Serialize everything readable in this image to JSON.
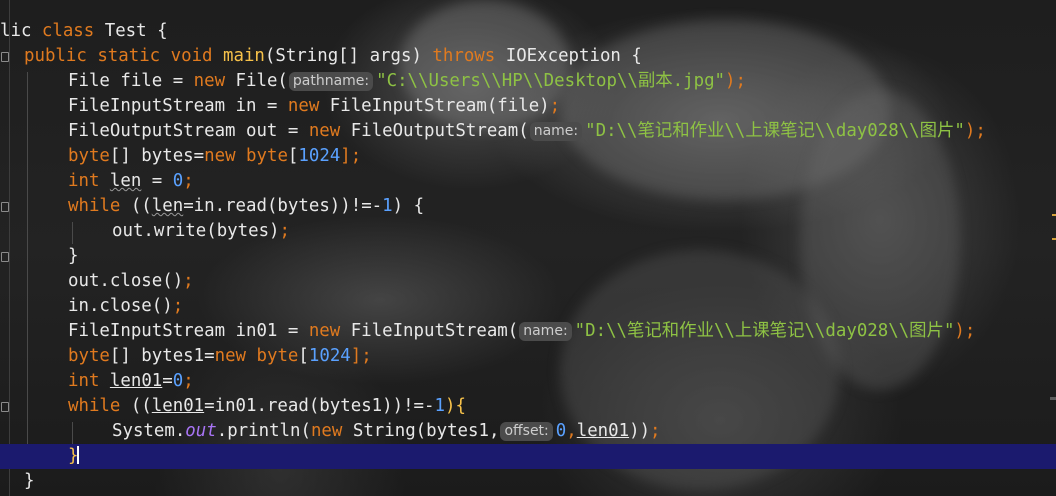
{
  "editor": {
    "colors": {
      "keyword": "#e07a1f",
      "method": "#f7c24a",
      "number": "#5aa1ff",
      "string": "#8ec244",
      "field": "#a874f4",
      "text": "#e8e8e8",
      "current_line": "#1b1a6e"
    },
    "lines": {
      "l1": {
        "a": "lic ",
        "b": "class",
        "c": " Test {"
      },
      "l2": {
        "a": "public",
        "b": " ",
        "c": "static",
        "d": " ",
        "e": "void",
        "f": " ",
        "g": "main",
        "h": "(String[] args) ",
        "i": "throws",
        "j": " IOException {"
      },
      "l3": {
        "a": "File file = ",
        "b": "new",
        "c": " File(",
        "hint": "pathname:",
        "str": "\"C:\\\\Users\\\\HP\\\\Desktop\\\\副本.jpg\"",
        "end": ");"
      },
      "l4": {
        "a": "FileInputStream in = ",
        "b": "new",
        "c": " FileInputStream(file)",
        "d": ";"
      },
      "l5": {
        "a": "FileOutputStream out = ",
        "b": "new",
        "c": " FileOutputStream(",
        "hint": "name:",
        "str": "\"D:\\\\笔记和作业\\\\上课笔记\\\\day028\\\\图片\"",
        "end": ");"
      },
      "l6": {
        "a": "byte",
        "b": "[] bytes=",
        "c": "new",
        "d": " ",
        "e": "byte",
        "f": "[",
        "g": "1024",
        "h": "];"
      },
      "l7": {
        "a": "int",
        "b": " ",
        "c": "len",
        "d": " = ",
        "e": "0",
        "f": ";"
      },
      "l8": {
        "a": "while",
        "b": " ((",
        "c": "len",
        "d": "=in.read(bytes))!=-",
        "e": "1",
        "f": ") {"
      },
      "l9": {
        "a": "out.write(bytes)",
        "b": ";"
      },
      "l10": {
        "a": "}"
      },
      "l11": {
        "a": "out.close()",
        "b": ";"
      },
      "l12": {
        "a": "in.close()",
        "b": ";"
      },
      "l13": {
        "a": "FileInputStream in01 = ",
        "b": "new",
        "c": " FileInputStream(",
        "hint": "name:",
        "str": "\"D:\\\\笔记和作业\\\\上课笔记\\\\day028\\\\图片\"",
        "end": ");"
      },
      "l14": {
        "a": "byte",
        "b": "[] bytes1=",
        "c": "new",
        "d": " ",
        "e": "byte",
        "f": "[",
        "g": "1024",
        "h": "];"
      },
      "l15": {
        "a": "int",
        "b": " ",
        "c": "len01",
        "d": "=",
        "e": "0",
        "f": ";"
      },
      "l16": {
        "a": "while",
        "b": " ((",
        "c": "len01",
        "d": "=in01.read(bytes1))!=-",
        "e": "1",
        "f": "){"
      },
      "l17": {
        "a": "System.",
        "b": "out",
        "c": ".println(",
        "d": "new",
        "e": " String(bytes1,",
        "hint": "offset:",
        "f": "0",
        "g": ",",
        "h": "len01",
        "i": "))",
        "j": ";"
      },
      "l18": {
        "a": "}"
      },
      "l19": {
        "a": "}"
      }
    }
  }
}
